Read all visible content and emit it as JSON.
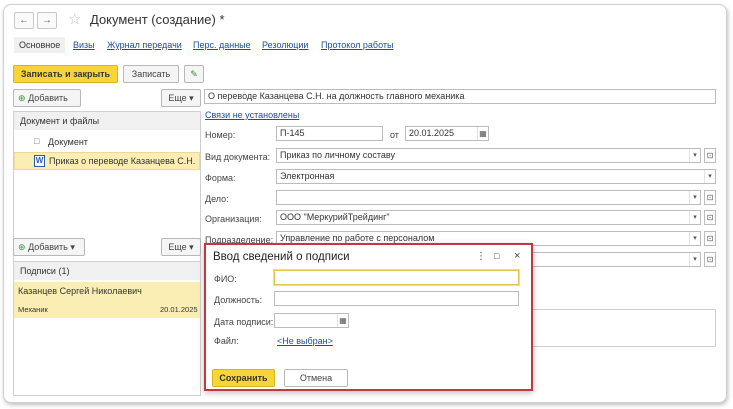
{
  "window": {
    "title": "Документ (создание) *",
    "back": "←",
    "forward": "→"
  },
  "tabs": [
    {
      "label": "Основное"
    },
    {
      "label": "Визы"
    },
    {
      "label": "Журнал передачи"
    },
    {
      "label": "Перс. данные"
    },
    {
      "label": "Резолюции"
    },
    {
      "label": "Протокол работы"
    }
  ],
  "toolbar": {
    "save_close": "Записать и закрыть",
    "save": "Записать",
    "edit_icon": "✎"
  },
  "files_panel": {
    "add": "Добавить",
    "more": "Еще",
    "header": "Документ и файлы",
    "items": [
      {
        "label": "Документ",
        "icon": "□"
      },
      {
        "label": "Приказ о переводе Казанцева С.Н.",
        "icon": "W"
      }
    ]
  },
  "signatures_panel": {
    "add": "Добавить",
    "more": "Еще",
    "header": "Подписи (1)",
    "signer_name": "Казанцев Сергей Николаевич",
    "signer_role": "Механик",
    "signer_date": "20.01.2025"
  },
  "form": {
    "subject": "О переводе Казанцева С.Н. на должность главного механика",
    "links": "Связи не установлены",
    "number_label": "Номер:",
    "number": "П-145",
    "from_label": "от",
    "date": "20.01.2025",
    "doc_type_label": "Вид документа:",
    "doc_type": "Приказ по личному составу",
    "form_label": "Форма:",
    "form_value": "Электронная",
    "case_label": "Дело:",
    "case_value": "",
    "org_label": "Организация:",
    "org_value": "ООО \"МеркурийТрейдинг\"",
    "dept_label": "Подразделение:",
    "dept_value": "Управление по работе с персоналом"
  },
  "modal": {
    "title": "Ввод сведений о подписи",
    "fio_label": "ФИО:",
    "fio_value": "",
    "position_label": "Должность:",
    "position_value": "",
    "date_label": "Дата подписи:",
    "date_value": "",
    "file_label": "Файл:",
    "file_value": "<Не выбран>",
    "save": "Сохранить",
    "cancel": "Отмена"
  }
}
